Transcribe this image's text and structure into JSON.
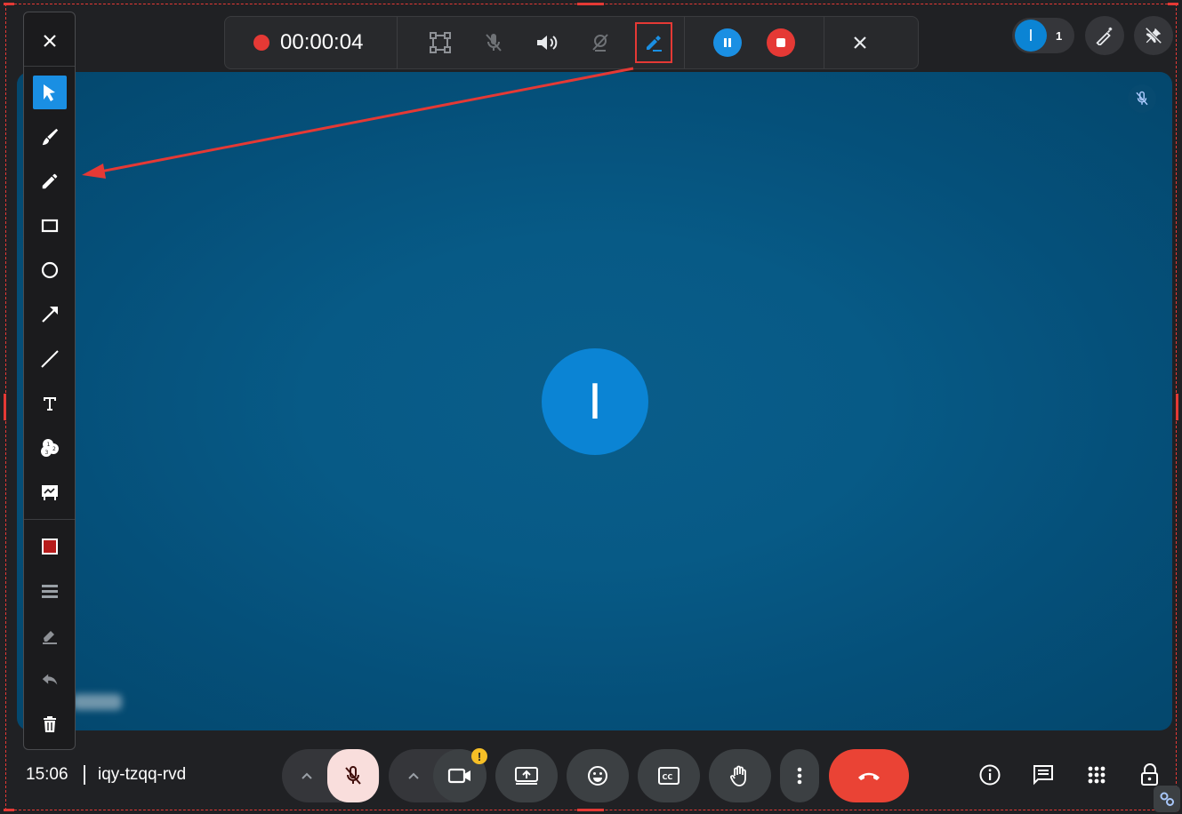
{
  "recording": {
    "time": "00:00:04"
  },
  "participants": {
    "avatar_letter": "I",
    "count": "1"
  },
  "stage": {
    "avatar_letter": "I"
  },
  "meeting": {
    "time": "15:06",
    "code": "iqy-tzqq-rvd"
  },
  "annotation_tools": [
    "select-icon",
    "brush-icon",
    "pencil-icon",
    "rectangle-icon",
    "circle-icon",
    "arrow-icon",
    "line-icon",
    "text-icon",
    "numbered-stamp-icon",
    "whiteboard-icon",
    "color-swatch-icon",
    "line-width-icon",
    "eraser-icon",
    "undo-icon",
    "delete-icon"
  ],
  "colors": {
    "accent": "#1a8fe3",
    "record": "#e53935",
    "hangup": "#ea4335",
    "selected_color": "#b71c1c",
    "stage": "#075a86",
    "warning": "#f6bf26"
  },
  "warning_badge": "!"
}
